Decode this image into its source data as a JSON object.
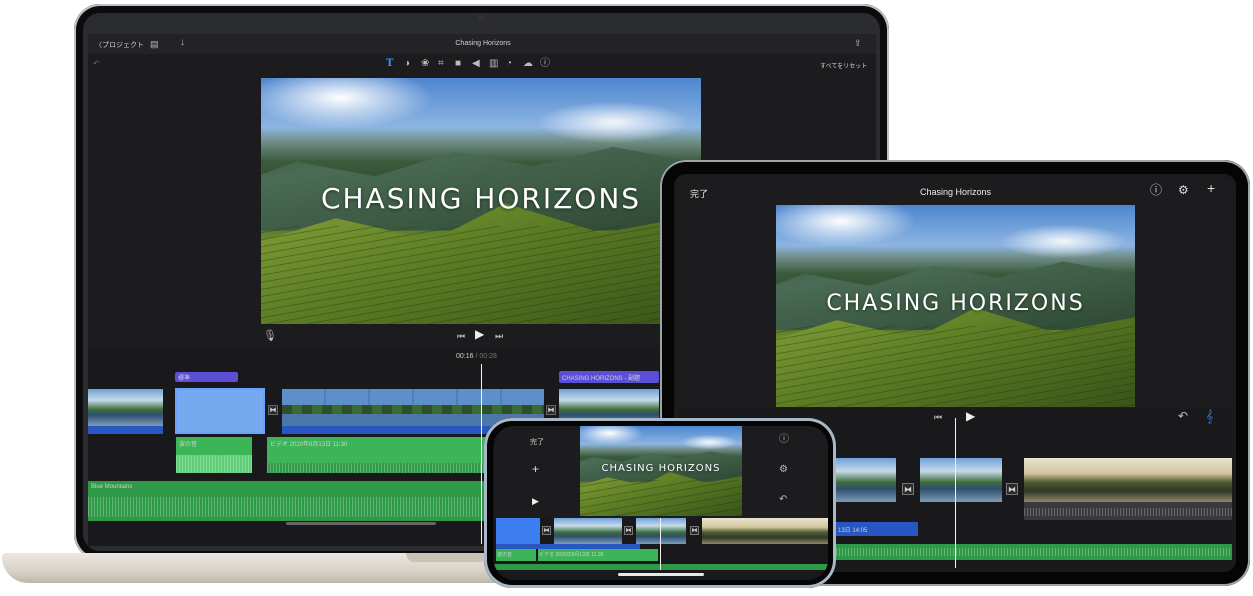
{
  "mac": {
    "back_label": "〈プロジェクト",
    "title": "Chasing Horizons",
    "reset_label": "すべてをリセット",
    "video_title": "CHASING HORIZONS",
    "timecode_current": "00:16",
    "timecode_separator": "/",
    "timecode_total": "00:28",
    "clip_label_standard": "標準",
    "clip_label_title": "CHASING HORIZONS - 副題",
    "audio_label_waves": "波の音",
    "audio_label_video": "ビデオ 2020年8月13日 11:30",
    "music_label": "Blue Mountains"
  },
  "ipad": {
    "done_label": "完了",
    "title": "Chasing Horizons",
    "video_title": "CHASING HORIZONS",
    "clip_label": "13日 14:05"
  },
  "iphone": {
    "done_label": "完了",
    "video_title": "CHASING HORIZONS",
    "audio_label_waves": "波の音",
    "audio_label_video": "ビデオ 2020年8月13日 11:30"
  },
  "colors": {
    "accent_blue": "#2857c2",
    "audio_green": "#3bb558",
    "title_purple": "#5a4fd6",
    "app_background": "#1c1c1e"
  },
  "icons": [
    "chevron-left-icon",
    "layout-icon",
    "download-icon",
    "share-icon",
    "undo-icon",
    "text-icon",
    "filter-icon",
    "color-icon",
    "crop-icon",
    "camera-icon",
    "volume-icon",
    "equalizer-icon",
    "speed-icon",
    "noise-icon",
    "info-icon",
    "mic-icon",
    "skip-back-icon",
    "play-icon",
    "skip-forward-icon",
    "help-icon",
    "gear-icon",
    "plus-icon",
    "waveform-icon",
    "transition-icon"
  ]
}
